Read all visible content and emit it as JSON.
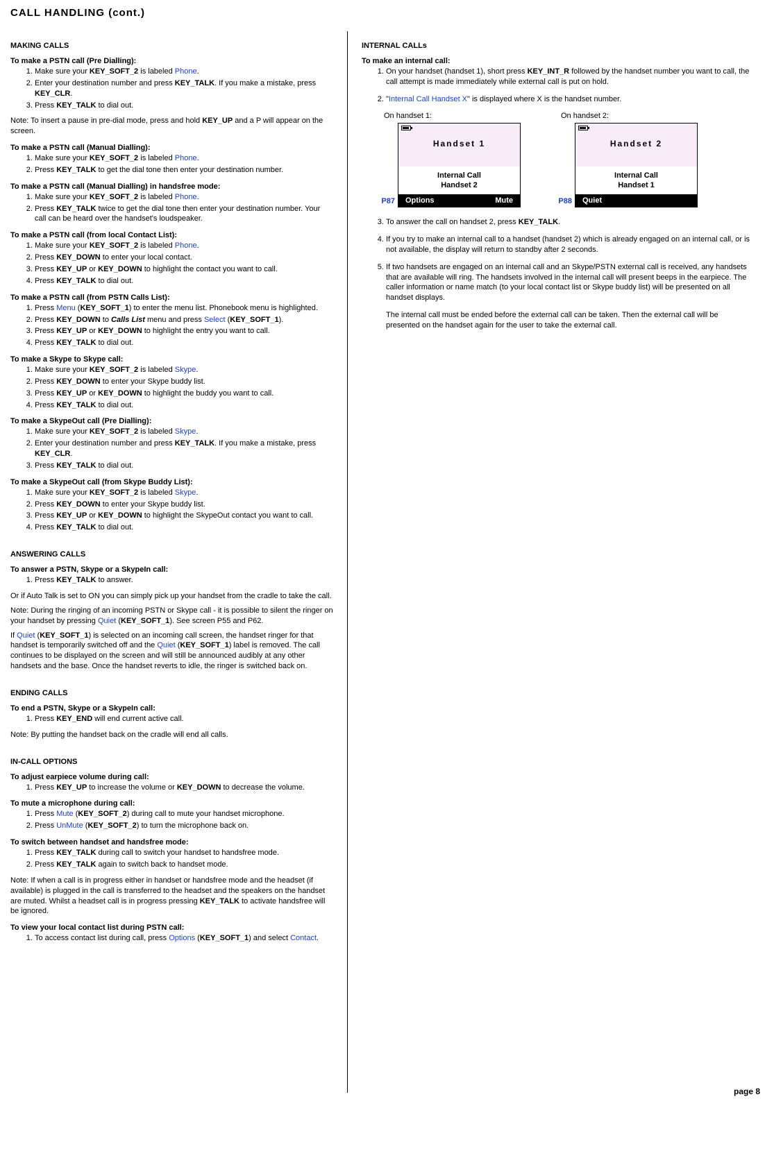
{
  "page_title": "CALL HANDLING (cont.)",
  "page_number": "page 8",
  "left": {
    "making_calls": "MAKING CALLS",
    "pstn_pre_head": "To make a PSTN call (Pre Dialling):",
    "pstn_pre": [
      {
        "pre": "Make sure your ",
        "b1": "KEY_SOFT_2",
        "mid": " is labeled ",
        "blue": "Phone",
        "post": "."
      },
      {
        "pre": "Enter your destination number and press ",
        "b1": "KEY_TALK",
        "mid": ". If you make a mistake, press ",
        "b2": "KEY_CLR",
        "post": "."
      },
      {
        "pre": "Press ",
        "b1": "KEY_TALK",
        "post": " to dial out."
      }
    ],
    "pstn_pre_note_pre": "Note: To insert a pause in pre-dial mode, press and hold ",
    "pstn_pre_note_b": "KEY_UP",
    "pstn_pre_note_post": " and a P will appear on the screen.",
    "pstn_manual_head": "To make a PSTN call (Manual Dialling):",
    "pstn_manual": [
      {
        "pre": "Make sure your ",
        "b1": "KEY_SOFT_2",
        "mid": " is labeled ",
        "blue": "Phone",
        "post": "."
      },
      {
        "pre": "Press ",
        "b1": "KEY_TALK",
        "post": " to get the dial tone then enter your destination number."
      }
    ],
    "pstn_hf_head": "To make a PSTN call (Manual Dialling) in handsfree mode:",
    "pstn_hf": [
      {
        "pre": "Make sure your ",
        "b1": "KEY_SOFT_2",
        "mid": " is labeled ",
        "blue": "Phone",
        "post": "."
      },
      {
        "pre": "Press ",
        "b1": "KEY_TALK",
        "post": " twice to get the dial tone then enter your destination number. Your call can be heard over the handset's loudspeaker."
      }
    ],
    "pstn_local_head": "To make a PSTN call (from local Contact List):",
    "pstn_local": [
      {
        "pre": "Make sure your ",
        "b1": "KEY_SOFT_2",
        "mid": " is labeled ",
        "blue": "Phone",
        "post": "."
      },
      {
        "pre": "Press ",
        "b1": "KEY_DOWN",
        "post": " to enter your local contact."
      },
      {
        "pre": "Press ",
        "b1": "KEY_UP",
        "mid": " or ",
        "b2": "KEY_DOWN",
        "post": " to highlight the contact you want to call."
      },
      {
        "pre": "Press ",
        "b1": "KEY_TALK",
        "post": " to dial out."
      }
    ],
    "pstn_calls_head": "To make a PSTN call (from PSTN Calls List):",
    "pstn_calls": [
      {
        "pre": "Press ",
        "blue": "Menu",
        "mid": " (",
        "b1": "KEY_SOFT_1",
        "post": ") to enter the menu list. Phonebook menu is highlighted."
      },
      {
        "pre": "Press ",
        "b1": "KEY_DOWN",
        "mid": " to ",
        "bi": "Calls List",
        "mid2": " menu and press ",
        "blue": "Select",
        "mid3": " (",
        "b2": "KEY_SOFT_1",
        "post": ")."
      },
      {
        "pre": "Press ",
        "b1": "KEY_UP",
        "mid": " or ",
        "b2": "KEY_DOWN",
        "post": " to highlight the entry you want to call."
      },
      {
        "pre": "Press ",
        "b1": "KEY_TALK",
        "post": " to dial out."
      }
    ],
    "skype_head": "To make a Skype to Skype call:",
    "skype": [
      {
        "pre": "Make sure your ",
        "b1": "KEY_SOFT_2",
        "mid": " is labeled ",
        "blue": "Skype",
        "post": "."
      },
      {
        "pre": "Press ",
        "b1": "KEY_DOWN",
        "post": " to enter your Skype buddy list."
      },
      {
        "pre": "Press ",
        "b1": "KEY_UP",
        "mid": " or ",
        "b2": "KEY_DOWN",
        "post": " to highlight the buddy you want to call."
      },
      {
        "pre": "Press ",
        "b1": "KEY_TALK",
        "post": " to dial out."
      }
    ],
    "skypeout_pre_head": "To make a SkypeOut call (Pre Dialling):",
    "skypeout_pre": [
      {
        "pre": "Make sure your ",
        "b1": "KEY_SOFT_2",
        "mid": " is labeled ",
        "blue": "Skype",
        "post": "."
      },
      {
        "pre": "Enter your destination number and press ",
        "b1": "KEY_TALK",
        "mid": ". If you make a mistake, press ",
        "b2": "KEY_CLR",
        "post": "."
      },
      {
        "pre": "Press ",
        "b1": "KEY_TALK",
        "post": " to dial out."
      }
    ],
    "skypeout_buddy_head": "To make a SkypeOut call (from Skype Buddy List):",
    "skypeout_buddy": [
      {
        "pre": "Make sure your ",
        "b1": "KEY_SOFT_2",
        "mid": " is labeled ",
        "blue": "Skype",
        "post": "."
      },
      {
        "pre": "Press ",
        "b1": "KEY_DOWN",
        "post": " to enter your Skype buddy list."
      },
      {
        "pre": "Press ",
        "b1": "KEY_UP",
        "mid": " or ",
        "b2": "KEY_DOWN",
        "post": " to highlight the SkypeOut contact you want to call."
      },
      {
        "pre": "Press ",
        "b1": "KEY_TALK",
        "post": " to dial out."
      }
    ],
    "answering": "ANSWERING CALLS",
    "answer_head": "To answer a PSTN, Skype or a SkypeIn call:",
    "answer_step_pre": "Press ",
    "answer_step_b": "KEY_TALK",
    "answer_step_post": " to answer.",
    "answer_note1": "Or if Auto Talk is set to ON you can simply pick up your handset from the cradle to take the call.",
    "answer_note2_pre": "Note: During the ringing of an incoming PSTN or Skype call - it is possible to silent the ringer on your handset by pressing ",
    "answer_note2_blue": "Quiet",
    "answer_note2_mid": " (",
    "answer_note2_b": "KEY_SOFT_1",
    "answer_note2_post": "). See screen P55 and P62.",
    "answer_note3_pre": "If ",
    "answer_note3_blue1": "Quiet",
    "answer_note3_mid1": " (",
    "answer_note3_b1": "KEY_SOFT_1",
    "answer_note3_mid2": ") is selected on an incoming call screen, the handset ringer for that handset is temporarily switched off and the ",
    "answer_note3_blue2": "Quiet",
    "answer_note3_mid3": " (",
    "answer_note3_b2": "KEY_SOFT_1",
    "answer_note3_post": ") label is removed. The call continues to be displayed on the screen and will still be announced audibly at any other handsets and the base. Once the handset reverts to idle, the ringer is switched back on.",
    "ending": "ENDING CALLS",
    "end_head": "To end a PSTN, Skype or a SkypeIn call:",
    "end_step_pre": "Press ",
    "end_step_b": "KEY_END",
    "end_step_post": " will end current active call.",
    "end_note": "Note: By putting the handset back on the cradle will end all calls.",
    "incall": "IN-CALL OPTIONS",
    "vol_head": "To adjust earpiece volume during call:",
    "vol_step_pre": "Press ",
    "vol_step_b1": "KEY_UP",
    "vol_step_mid": " to increase the volume or ",
    "vol_step_b2": "KEY_DOWN",
    "vol_step_post": " to decrease the volume.",
    "mute_head": "To mute a microphone during call:",
    "mute1_pre": "Press ",
    "mute1_blue": "Mute",
    "mute1_mid": " (",
    "mute1_b": "KEY_SOFT_2",
    "mute1_post": ") during call to mute your handset microphone.",
    "mute2_pre": "Press ",
    "mute2_blue": "UnMute",
    "mute2_mid": " (",
    "mute2_b": "KEY_SOFT_2",
    "mute2_post": ") to turn the microphone back on.",
    "switch_head": "To switch between handset and handsfree mode:",
    "switch1_pre": "Press ",
    "switch1_b": "KEY_TALK",
    "switch1_post": " during call to switch your handset to handsfree mode.",
    "switch2_pre": "Press ",
    "switch2_b": "KEY_TALK",
    "switch2_post": " again to switch back to handset mode.",
    "switch_note_pre": "Note: If when a call is in progress either in handset or handsfree mode and the headset (if available) is plugged in the call is transferred to the headset and the speakers on the handset are muted. Whilst a headset call is in progress pressing ",
    "switch_note_b": "KEY_TALK",
    "switch_note_post": " to activate handsfree will be ignored.",
    "view_head": "To view your local contact list during PSTN call:",
    "view_pre": "To access contact list during call, press ",
    "view_blue1": "Options",
    "view_mid1": " (",
    "view_b": "KEY_SOFT_1",
    "view_mid2": ") and select ",
    "view_blue2": "Contact",
    "view_post": "."
  },
  "right": {
    "internal": "INTERNAL CALLs",
    "int_head": "To make an internal call:",
    "int1_pre": "On your handset (handset 1), short press ",
    "int1_b": "KEY_INT_R",
    "int1_post": " followed by the handset number you want to call, the call attempt is made immediately while external call is put on hold.",
    "int2_pre": "\"",
    "int2_blue": "Internal Call Handset X",
    "int2_post": "\" is displayed where X is the handset number.",
    "phone1_caption": "On handset 1:",
    "phone2_caption": "On handset 2:",
    "p87": "P87",
    "p88": "P88",
    "phone1_title": "Handset    1",
    "phone1_mid1": "Internal Call",
    "phone1_mid2": "Handset 2",
    "phone1_left": "Options",
    "phone1_right": "Mute",
    "phone2_title": "Handset    2",
    "phone2_mid1": "Internal Call",
    "phone2_mid2": "Handset 1",
    "phone2_left": "Quiet",
    "phone2_right": "",
    "int3_pre": "To answer the call on handset 2, press ",
    "int3_b": "KEY_TALK",
    "int3_post": ".",
    "int4": "If you try to make an internal call to a handset (handset 2) which is already engaged on an internal call, or is not available, the display will return to standby after 2 seconds.",
    "int5": "If two handsets are engaged on an internal call and an Skype/PSTN external call is received, any handsets that are available will ring. The handsets involved in the internal call will present beeps in the earpiece. The caller information or name match (to your local contact list or Skype buddy list) will be presented on all handset displays.",
    "int5b": "The internal call must be ended before the external call can be taken. Then the external call will be presented on the handset again for the user to take the external call."
  }
}
